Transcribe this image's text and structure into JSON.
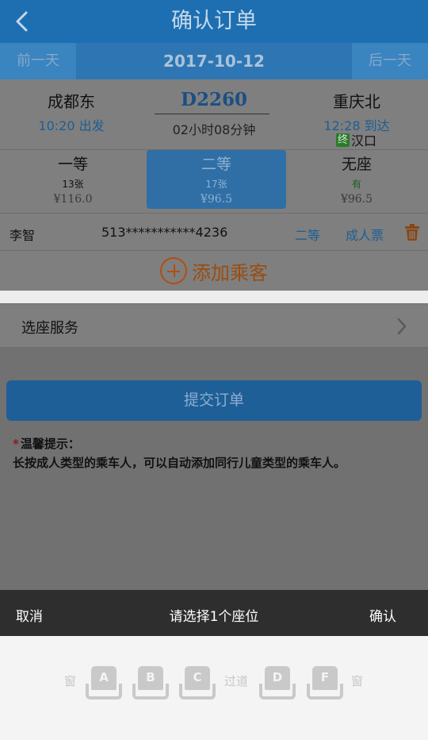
{
  "header": {
    "title": "确认订单"
  },
  "datebar": {
    "prev": "前一天",
    "date": "2017-10-12",
    "next": "后一天"
  },
  "train": {
    "from_station": "成都东",
    "from_time": "10:20 出发",
    "number": "D2260",
    "duration": "02小时08分钟",
    "to_station": "重庆北",
    "to_time": "12:28 到达",
    "terminal_badge": "终",
    "terminal": "汉口"
  },
  "seat_classes": [
    {
      "name": "一等",
      "count": "13张",
      "price": "¥116.0"
    },
    {
      "name": "二等",
      "count": "17张",
      "price": "¥96.5"
    },
    {
      "name": "无座",
      "count": "有",
      "price": "¥96.5"
    }
  ],
  "passenger": {
    "name": "李智",
    "id_number": "513***********4236",
    "seat_class": "二等",
    "ticket_type": "成人票"
  },
  "add_passenger": {
    "label": "添加乘客"
  },
  "seat_service": {
    "label": "选座服务"
  },
  "submit": {
    "label": "提交订单"
  },
  "tips": {
    "star": "*",
    "title": "温馨提示：",
    "text": "长按成人类型的乘车人，可以自动添加同行儿童类型的乘车人。"
  },
  "picker": {
    "cancel": "取消",
    "title": "请选择1个座位",
    "confirm": "确认",
    "window_left": "窗",
    "aisle": "过道",
    "window_right": "窗",
    "seats": [
      "A",
      "B",
      "C",
      "D",
      "F"
    ]
  },
  "colors": {
    "header": "#1d6fb2",
    "accent": "#2f6fa6",
    "add": "#b14e10"
  }
}
